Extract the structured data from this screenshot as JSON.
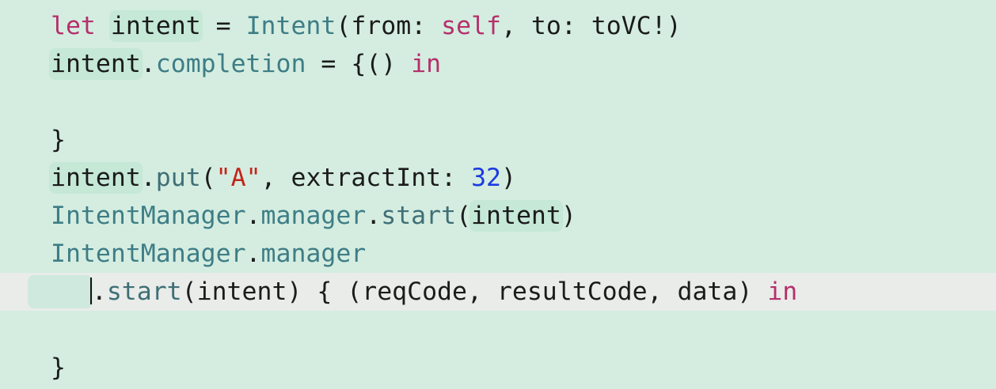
{
  "editor": {
    "lines": [
      [
        {
          "t": "let",
          "c": "kw"
        },
        {
          "t": " ",
          "c": "plain"
        },
        {
          "t": "intent",
          "c": "plain",
          "hl": true
        },
        {
          "t": " = ",
          "c": "plain"
        },
        {
          "t": "Intent",
          "c": "type"
        },
        {
          "t": "(from: ",
          "c": "plain"
        },
        {
          "t": "self",
          "c": "kw"
        },
        {
          "t": ", to: toVC!)",
          "c": "plain"
        }
      ],
      [
        {
          "t": "intent",
          "c": "plain",
          "hl": true
        },
        {
          "t": ".",
          "c": "plain"
        },
        {
          "t": "completion",
          "c": "prop"
        },
        {
          "t": " = {() ",
          "c": "plain"
        },
        {
          "t": "in",
          "c": "kw"
        }
      ],
      [],
      [
        {
          "t": "}",
          "c": "plain"
        }
      ],
      [
        {
          "t": "intent",
          "c": "plain",
          "hl": true
        },
        {
          "t": ".",
          "c": "plain"
        },
        {
          "t": "put",
          "c": "mem"
        },
        {
          "t": "(",
          "c": "plain"
        },
        {
          "t": "\"A\"",
          "c": "str"
        },
        {
          "t": ", extractInt: ",
          "c": "plain"
        },
        {
          "t": "32",
          "c": "num"
        },
        {
          "t": ")",
          "c": "plain"
        }
      ],
      [
        {
          "t": "IntentManager",
          "c": "type"
        },
        {
          "t": ".",
          "c": "plain"
        },
        {
          "t": "manager",
          "c": "prop"
        },
        {
          "t": ".",
          "c": "plain"
        },
        {
          "t": "start",
          "c": "mem"
        },
        {
          "t": "(",
          "c": "plain"
        },
        {
          "t": "intent",
          "c": "plain",
          "hl": true
        },
        {
          "t": ")",
          "c": "plain"
        }
      ],
      [
        {
          "t": "IntentManager",
          "c": "type"
        },
        {
          "t": ".",
          "c": "plain"
        },
        {
          "t": "manager",
          "c": "prop"
        }
      ],
      [
        {
          "t": "    ",
          "c": "plain",
          "ws": true
        },
        {
          "t": "",
          "caret": true
        },
        {
          "t": ".",
          "c": "plain"
        },
        {
          "t": "start",
          "c": "mem"
        },
        {
          "t": "(intent) { (reqCode, resultCode, data) ",
          "c": "plain"
        },
        {
          "t": "in",
          "c": "kw"
        }
      ],
      [],
      [
        {
          "t": "}",
          "c": "plain"
        }
      ]
    ]
  },
  "colors": {
    "background": "#d4ede0",
    "current_line": "#e9ece9",
    "keyword": "#b5306b",
    "type": "#3e7d86",
    "string": "#c4241a",
    "number": "#1c3be0",
    "symbol_highlight": "#c5e8d7"
  }
}
